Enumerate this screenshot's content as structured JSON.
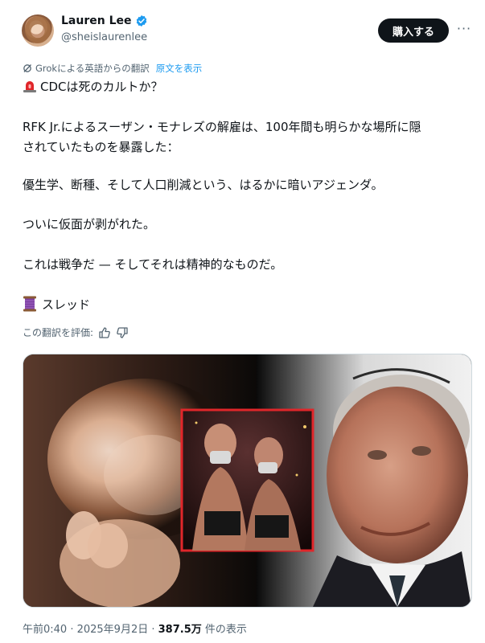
{
  "header": {
    "display_name": "Lauren Lee",
    "handle": "@sheislaurenlee",
    "buy_label": "購入する",
    "more_label": "···"
  },
  "translation": {
    "note": "Grokによる英語からの翻訳",
    "show_original": "原文を表示"
  },
  "body": {
    "title": "CDCは死のカルトか？",
    "p1_line1": "RFK Jr.によるスーザン・モナレズの解雇は、100年間も明らかな場所に隠",
    "p1_line2": "されていたものを暴露した：",
    "p2": "優生学、断種、そして人口削減という、はるかに暗いアジェンダ。",
    "p3": "ついに仮面が剥がれた。",
    "p4": "これは戦争だ — そしてそれは精神的なものだ。",
    "thread": "スレッド"
  },
  "rating": {
    "label": "この翻訳を評価:"
  },
  "footer": {
    "time": "午前0:40 · 2025年9月2日 · ",
    "views": "387.5万",
    "views_suffix": " 件の表示"
  },
  "colors": {
    "accent": "#1d9bf0",
    "text": "#0f1419",
    "muted": "#536471",
    "button_bg": "#0f1419",
    "inset_border": "#e0262a"
  },
  "icons": [
    "verified-badge-icon",
    "more-icon",
    "grok-icon",
    "siren-icon",
    "spool-icon",
    "thumbs-up-icon",
    "thumbs-down-icon"
  ]
}
